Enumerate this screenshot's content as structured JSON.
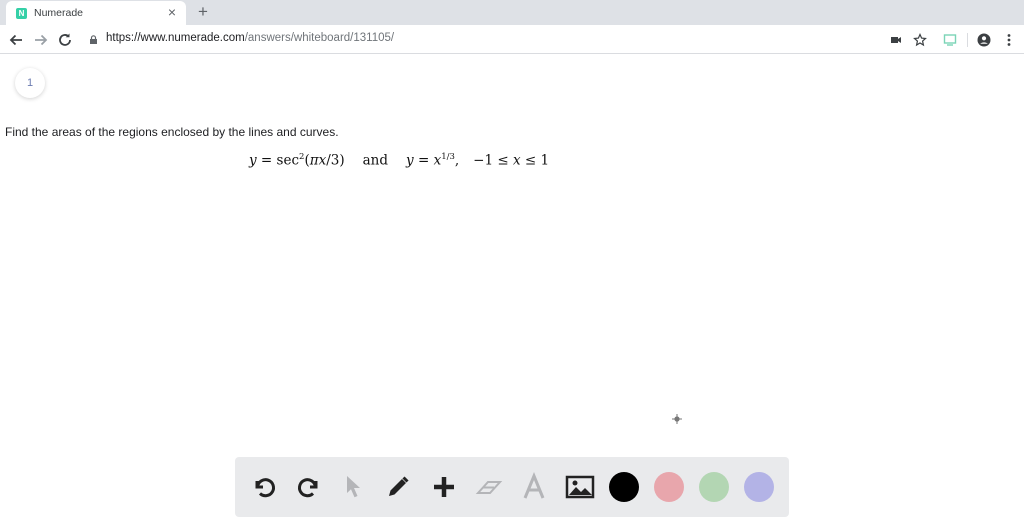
{
  "browser": {
    "tab_title": "Numerade",
    "favicon_letter": "N",
    "url_host": "https://www.numerade.com",
    "url_path": "/answers/whiteboard/131105/"
  },
  "page": {
    "page_number": "1",
    "question": "Find the areas of the regions enclosed by the lines and curves."
  },
  "equation": {
    "part1_y": "y",
    "part1_eq": " = sec",
    "part1_exp": "2",
    "part1_arg_open": "(",
    "part1_pi": "πx",
    "part1_arg_rest": "/3)",
    "and": "and",
    "part2_y": "y",
    "part2_eq": " = ",
    "part2_x": "x",
    "part2_exp": "1/3",
    "part2_comma": ",",
    "part3": "−1 ≤ ",
    "part3_x": "x",
    "part3_end": " ≤ 1"
  },
  "whiteboard": {
    "tools": [
      "undo-icon",
      "redo-icon",
      "pointer-icon",
      "pen-icon",
      "plus-icon",
      "eraser-icon",
      "text-icon",
      "image-icon"
    ],
    "colors": [
      "#000000",
      "#e8a6ac",
      "#b3d6b3",
      "#b3b3e6"
    ]
  }
}
